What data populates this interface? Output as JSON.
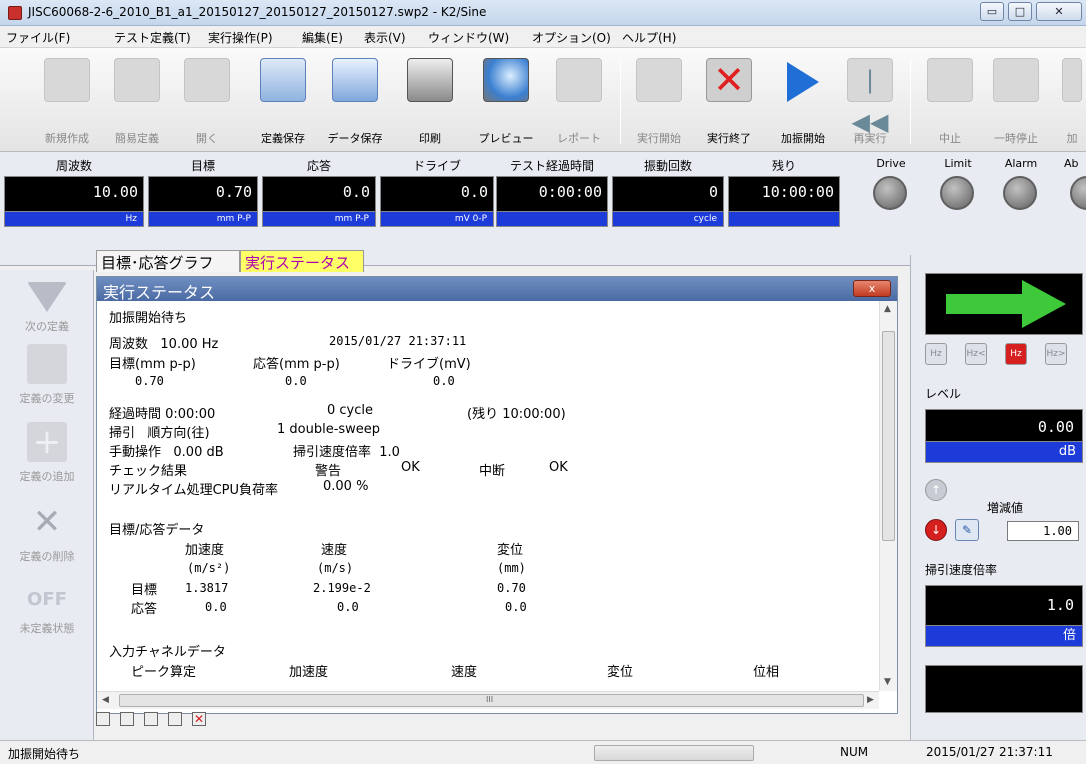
{
  "window": {
    "title": "JISC60068-2-6_2010_B1_a1_20150127_20150127_20150127.swp2 - K2/Sine",
    "min_label": "▭",
    "max_label": "□",
    "close_label": "✕"
  },
  "menu": [
    "ファイル(F)",
    "テスト定義(T)",
    "実行操作(P)",
    "編集(E)",
    "表示(V)",
    "ウィンドウ(W)",
    "オプション(O)",
    "ヘルプ(H)"
  ],
  "toolbar": [
    {
      "label": "新規作成",
      "enabled": false
    },
    {
      "label": "簡易定義",
      "enabled": false
    },
    {
      "label": "開く",
      "enabled": false
    },
    {
      "label": "定義保存",
      "enabled": true
    },
    {
      "label": "データ保存",
      "enabled": true
    },
    {
      "label": "印刷",
      "enabled": true
    },
    {
      "label": "プレビュー",
      "enabled": true
    },
    {
      "label": "レポート",
      "enabled": false
    },
    {
      "label": "実行開始",
      "enabled": false
    },
    {
      "label": "実行終了",
      "enabled": true
    },
    {
      "label": "加振開始",
      "enabled": true
    },
    {
      "label": "再実行",
      "enabled": false
    },
    {
      "label": "中止",
      "enabled": false
    },
    {
      "label": "一時停止",
      "enabled": false
    },
    {
      "label": "加",
      "enabled": false
    }
  ],
  "meters": [
    {
      "label": "周波数",
      "value": "10.00",
      "unit": "Hz"
    },
    {
      "label": "目標",
      "value": "0.70",
      "unit": "mm P-P"
    },
    {
      "label": "応答",
      "value": "0.0",
      "unit": "mm P-P"
    },
    {
      "label": "ドライブ",
      "value": "0.0",
      "unit": "mV 0-P"
    },
    {
      "label": "テスト経過時間",
      "value": "0:00:00",
      "unit": ""
    },
    {
      "label": "振動回数",
      "value": "0",
      "unit": "cycle"
    },
    {
      "label": "残り",
      "value": "10:00:00",
      "unit": ""
    }
  ],
  "lamps": [
    "Drive",
    "Limit",
    "Alarm",
    "Ab"
  ],
  "left_actions": [
    {
      "label": "次の定義"
    },
    {
      "label": "定義の変更"
    },
    {
      "label": "定義の追加"
    },
    {
      "label": "定義の削除"
    },
    {
      "label": "未定義状態",
      "icon_text": "OFF"
    }
  ],
  "tabs": [
    {
      "label": "目標･応答グラフ",
      "active": false
    },
    {
      "label": "実行ステータス",
      "active": true
    }
  ],
  "panel": {
    "title": "実行ステータス",
    "close": "x",
    "lines": {
      "state": "加振開始待ち",
      "freq": "周波数   10.00 Hz",
      "datetime": "2015/01/27 21:37:11",
      "h_target": "目標(mm p-p)",
      "h_resp": "応答(mm p-p)",
      "h_drive": "ドライブ(mV)",
      "v_target": "0.70",
      "v_resp": "0.0",
      "v_drive": "0.0",
      "elapsed": "経過時間 0:00:00",
      "cycles": "0 cycle",
      "remaining": "(残り 10:00:00)",
      "sweep": "掃引   順方向(往)",
      "sweep_count": "1 double-sweep",
      "manual": "手動操作   0.00 dB",
      "sweep_rate": "掃引速度倍率  1.0",
      "check": "チェック結果",
      "warn": "警告",
      "warn_val": "OK",
      "abort": "中断",
      "abort_val": "OK",
      "cpu": "リアルタイム処理CPU負荷率",
      "cpu_val": "0.00 %",
      "data_title": "目標/応答データ",
      "col_acc": "加速度",
      "col_vel": "速度",
      "col_disp": "変位",
      "unit_acc": "(m/s²)",
      "unit_vel": "(m/s)",
      "unit_disp": "(mm)",
      "row_target": "目標",
      "row_target_acc": "1.3817",
      "row_target_vel": "2.199e-2",
      "row_target_disp": "0.70",
      "row_resp": "応答",
      "row_resp_acc": "0.0",
      "row_resp_vel": "0.0",
      "row_resp_disp": "0.0",
      "input_title": "入力チャネルデータ",
      "ic_peak": "ピーク算定",
      "ic_acc": "加速度",
      "ic_vel": "速度",
      "ic_disp": "変位",
      "ic_phase": "位相"
    },
    "hscroll_mark": "III"
  },
  "right_panel": {
    "level_label": "レベル",
    "level_value": "0.00",
    "level_unit": "dB",
    "step_label": "増減値",
    "step_value": "1.00",
    "rate_label": "掃引速度倍率",
    "rate_value": "1.0",
    "rate_unit": "倍",
    "hz_buttons": [
      "Hz",
      "Hz<",
      "Hz",
      "Hz>"
    ]
  },
  "status": {
    "text": "加振開始待ち",
    "num": "NUM",
    "datetime": "2015/01/27  21:37:11"
  },
  "colors": {
    "meter_bg": "#000000",
    "unit_bar": "#1d3bd8",
    "panel_header": "#4a6aa3",
    "active_tab": "#ffff66",
    "go_arrow": "#3ec93a",
    "stop_red": "#d62020"
  }
}
